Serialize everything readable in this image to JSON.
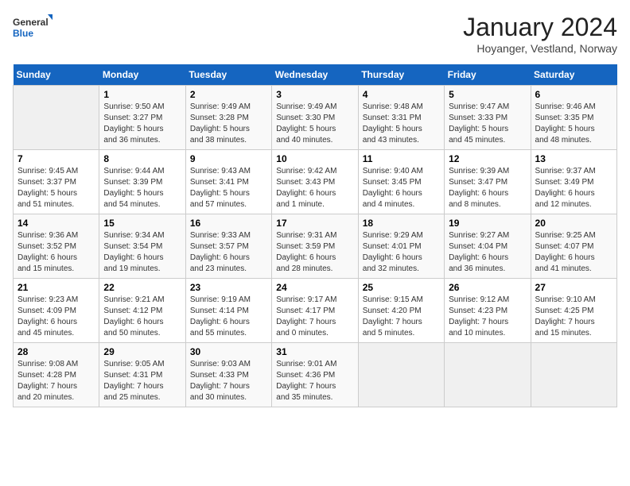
{
  "header": {
    "logo_general": "General",
    "logo_blue": "Blue",
    "month_title": "January 2024",
    "location": "Hoyanger, Vestland, Norway"
  },
  "days_of_week": [
    "Sunday",
    "Monday",
    "Tuesday",
    "Wednesday",
    "Thursday",
    "Friday",
    "Saturday"
  ],
  "weeks": [
    [
      {
        "day": "",
        "info": ""
      },
      {
        "day": "1",
        "info": "Sunrise: 9:50 AM\nSunset: 3:27 PM\nDaylight: 5 hours\nand 36 minutes."
      },
      {
        "day": "2",
        "info": "Sunrise: 9:49 AM\nSunset: 3:28 PM\nDaylight: 5 hours\nand 38 minutes."
      },
      {
        "day": "3",
        "info": "Sunrise: 9:49 AM\nSunset: 3:30 PM\nDaylight: 5 hours\nand 40 minutes."
      },
      {
        "day": "4",
        "info": "Sunrise: 9:48 AM\nSunset: 3:31 PM\nDaylight: 5 hours\nand 43 minutes."
      },
      {
        "day": "5",
        "info": "Sunrise: 9:47 AM\nSunset: 3:33 PM\nDaylight: 5 hours\nand 45 minutes."
      },
      {
        "day": "6",
        "info": "Sunrise: 9:46 AM\nSunset: 3:35 PM\nDaylight: 5 hours\nand 48 minutes."
      }
    ],
    [
      {
        "day": "7",
        "info": "Sunrise: 9:45 AM\nSunset: 3:37 PM\nDaylight: 5 hours\nand 51 minutes."
      },
      {
        "day": "8",
        "info": "Sunrise: 9:44 AM\nSunset: 3:39 PM\nDaylight: 5 hours\nand 54 minutes."
      },
      {
        "day": "9",
        "info": "Sunrise: 9:43 AM\nSunset: 3:41 PM\nDaylight: 5 hours\nand 57 minutes."
      },
      {
        "day": "10",
        "info": "Sunrise: 9:42 AM\nSunset: 3:43 PM\nDaylight: 6 hours\nand 1 minute."
      },
      {
        "day": "11",
        "info": "Sunrise: 9:40 AM\nSunset: 3:45 PM\nDaylight: 6 hours\nand 4 minutes."
      },
      {
        "day": "12",
        "info": "Sunrise: 9:39 AM\nSunset: 3:47 PM\nDaylight: 6 hours\nand 8 minutes."
      },
      {
        "day": "13",
        "info": "Sunrise: 9:37 AM\nSunset: 3:49 PM\nDaylight: 6 hours\nand 12 minutes."
      }
    ],
    [
      {
        "day": "14",
        "info": "Sunrise: 9:36 AM\nSunset: 3:52 PM\nDaylight: 6 hours\nand 15 minutes."
      },
      {
        "day": "15",
        "info": "Sunrise: 9:34 AM\nSunset: 3:54 PM\nDaylight: 6 hours\nand 19 minutes."
      },
      {
        "day": "16",
        "info": "Sunrise: 9:33 AM\nSunset: 3:57 PM\nDaylight: 6 hours\nand 23 minutes."
      },
      {
        "day": "17",
        "info": "Sunrise: 9:31 AM\nSunset: 3:59 PM\nDaylight: 6 hours\nand 28 minutes."
      },
      {
        "day": "18",
        "info": "Sunrise: 9:29 AM\nSunset: 4:01 PM\nDaylight: 6 hours\nand 32 minutes."
      },
      {
        "day": "19",
        "info": "Sunrise: 9:27 AM\nSunset: 4:04 PM\nDaylight: 6 hours\nand 36 minutes."
      },
      {
        "day": "20",
        "info": "Sunrise: 9:25 AM\nSunset: 4:07 PM\nDaylight: 6 hours\nand 41 minutes."
      }
    ],
    [
      {
        "day": "21",
        "info": "Sunrise: 9:23 AM\nSunset: 4:09 PM\nDaylight: 6 hours\nand 45 minutes."
      },
      {
        "day": "22",
        "info": "Sunrise: 9:21 AM\nSunset: 4:12 PM\nDaylight: 6 hours\nand 50 minutes."
      },
      {
        "day": "23",
        "info": "Sunrise: 9:19 AM\nSunset: 4:14 PM\nDaylight: 6 hours\nand 55 minutes."
      },
      {
        "day": "24",
        "info": "Sunrise: 9:17 AM\nSunset: 4:17 PM\nDaylight: 7 hours\nand 0 minutes."
      },
      {
        "day": "25",
        "info": "Sunrise: 9:15 AM\nSunset: 4:20 PM\nDaylight: 7 hours\nand 5 minutes."
      },
      {
        "day": "26",
        "info": "Sunrise: 9:12 AM\nSunset: 4:23 PM\nDaylight: 7 hours\nand 10 minutes."
      },
      {
        "day": "27",
        "info": "Sunrise: 9:10 AM\nSunset: 4:25 PM\nDaylight: 7 hours\nand 15 minutes."
      }
    ],
    [
      {
        "day": "28",
        "info": "Sunrise: 9:08 AM\nSunset: 4:28 PM\nDaylight: 7 hours\nand 20 minutes."
      },
      {
        "day": "29",
        "info": "Sunrise: 9:05 AM\nSunset: 4:31 PM\nDaylight: 7 hours\nand 25 minutes."
      },
      {
        "day": "30",
        "info": "Sunrise: 9:03 AM\nSunset: 4:33 PM\nDaylight: 7 hours\nand 30 minutes."
      },
      {
        "day": "31",
        "info": "Sunrise: 9:01 AM\nSunset: 4:36 PM\nDaylight: 7 hours\nand 35 minutes."
      },
      {
        "day": "",
        "info": ""
      },
      {
        "day": "",
        "info": ""
      },
      {
        "day": "",
        "info": ""
      }
    ]
  ]
}
